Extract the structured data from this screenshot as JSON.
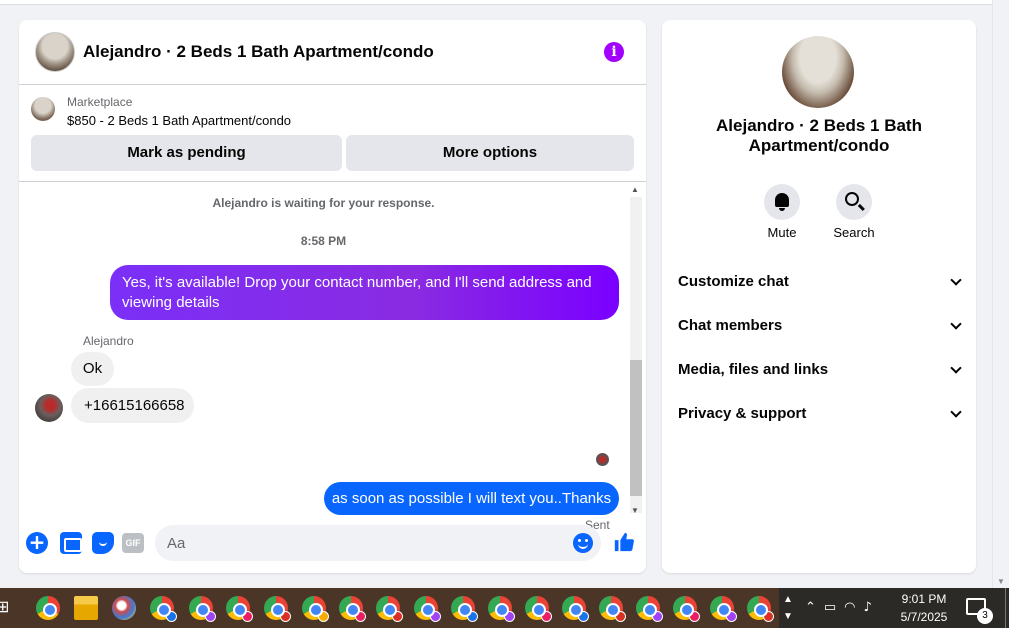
{
  "chat": {
    "title": "Alejandro · 2 Beds 1 Bath Apartment/condo",
    "info_icon_label": "i",
    "marketplace": {
      "label": "Marketplace",
      "listing": "$850 - 2 Beds 1 Bath Apartment/condo",
      "mark_pending": "Mark as pending",
      "more_options": "More options"
    },
    "messages": {
      "waiting": "Alejandro is waiting for your response.",
      "timestamp": "8:58 PM",
      "outgoing_1": "Yes, it's available! Drop your contact number, and I'll send address and viewing details",
      "sender_name": "Alejandro",
      "incoming_1": "Ok",
      "incoming_2": "+16615166658",
      "outgoing_2": "as soon as possible I will text you..Thanks",
      "status": "Sent"
    },
    "composer": {
      "placeholder": "Aa",
      "value": "",
      "gif_label": "GIF",
      "plus_label": "+"
    }
  },
  "info_panel": {
    "name": "Alejandro · 2 Beds 1 Bath Apartment/condo",
    "actions": {
      "mute": "Mute",
      "search": "Search"
    },
    "sections": {
      "customize": "Customize chat",
      "members": "Chat members",
      "media": "Media, files and links",
      "privacy": "Privacy & support"
    }
  },
  "taskbar": {
    "time": "9:01 PM",
    "date": "5/7/2025",
    "notification_count": "3",
    "apps": [
      "task-view",
      "chrome",
      "file-explorer",
      "paint",
      "chrome-profile-a",
      "chrome-profile",
      "chrome-profile",
      "chrome-profile",
      "chrome-profile",
      "chrome-profile",
      "chrome-profile",
      "chrome-profile",
      "chrome-profile",
      "chrome-profile",
      "chrome-profile",
      "chrome-profile",
      "chrome-profile",
      "chrome-profile",
      "chrome-profile",
      "chrome-profile",
      "chrome-profile"
    ]
  },
  "colors": {
    "accent_blue": "#0866ff",
    "accent_purple": "#8a2be2",
    "info_purple": "#a200ff",
    "taskbar_bg": "#4a3526"
  }
}
